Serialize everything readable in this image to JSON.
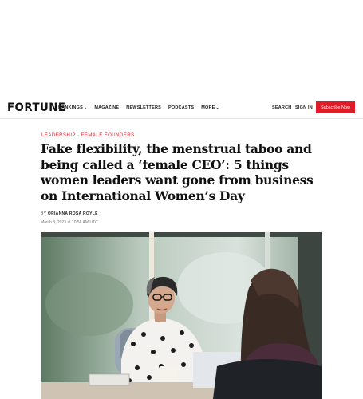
{
  "header": {
    "logo": "FORTUNE",
    "nav": [
      {
        "label": "RANKINGS",
        "dropdown": true
      },
      {
        "label": "MAGAZINE",
        "dropdown": false
      },
      {
        "label": "NEWSLETTERS",
        "dropdown": false
      },
      {
        "label": "PODCASTS",
        "dropdown": false
      },
      {
        "label": "MORE",
        "dropdown": true
      }
    ],
    "search_label": "SEARCH",
    "signin_label": "SIGN IN",
    "subscribe_label": "Subscribe Now"
  },
  "article": {
    "category": {
      "primary": "LEADERSHIP",
      "separator": " · ",
      "secondary": "FEMALE FOUNDERS"
    },
    "headline": "Fake flexibility, the menstrual taboo and being called a ‘female CEO’: 5 things women leaders want gone from business on International Women’s Day",
    "byline_prefix": "BY",
    "author": "ORIANNA ROSA ROYLE",
    "date": "March 8, 2023 at 10:56 AM UTC"
  },
  "colors": {
    "accent": "#e01c29",
    "text": "#111111"
  },
  "icons": {
    "dropdown": "chevron-down-icon"
  }
}
